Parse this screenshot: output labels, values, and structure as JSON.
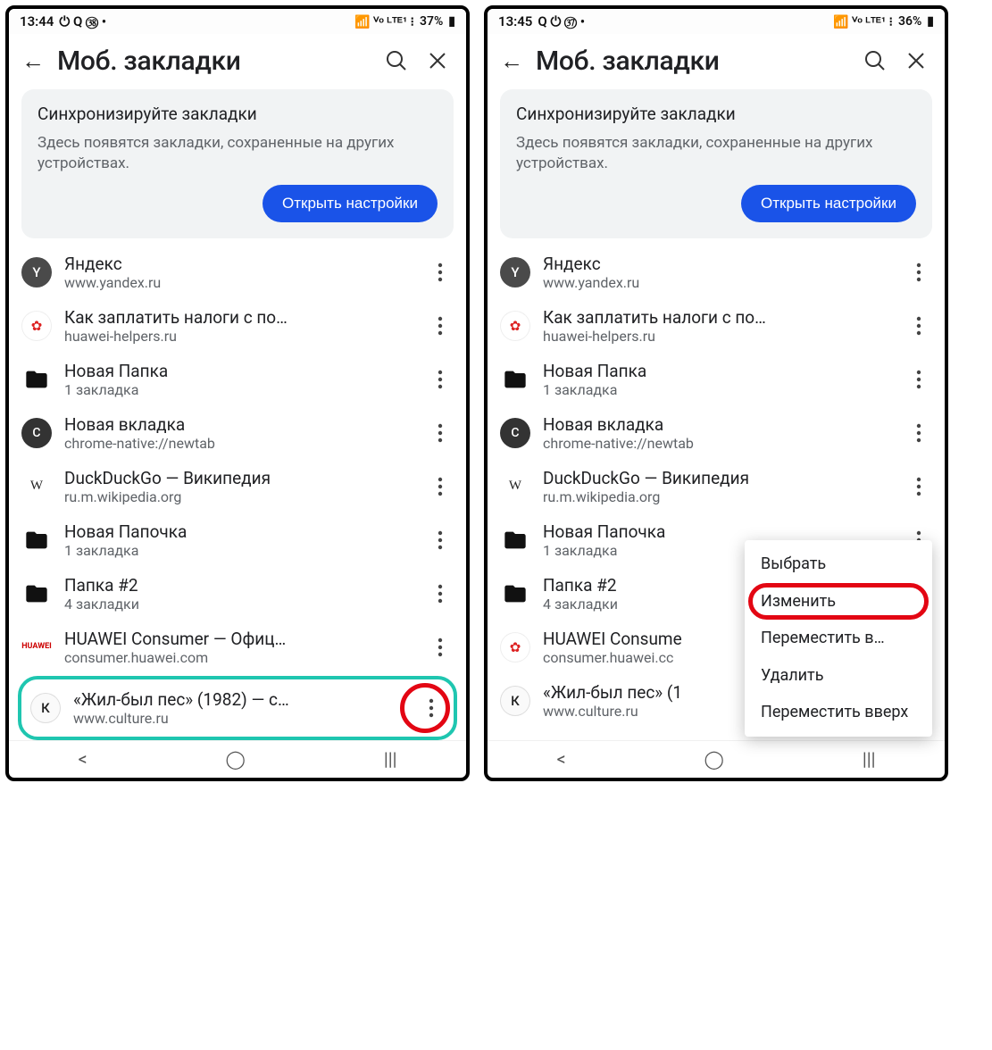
{
  "screens": [
    {
      "id": "left",
      "statusbar": {
        "time": "13:44",
        "battery": "37%",
        "icons": "⏻ Q ㊳ •",
        "net": "📶 ⱽᵒ ᴸᵀᴱ¹ ⁝"
      },
      "header": {
        "title": "Моб. закладки"
      },
      "sync": {
        "heading": "Синхронизируйте закладки",
        "sub": "Здесь появятся закладки, сохраненные на других устройствах.",
        "button": "Открыть настройки"
      },
      "bookmarks": [
        {
          "fav": "Y",
          "favClass": "fav-y",
          "title": "Яндекс",
          "url": "www.yandex.ru"
        },
        {
          "fav": "✿",
          "favClass": "fav-huawei",
          "title": "Как заплатить налоги с по…",
          "url": "huawei-helpers.ru"
        },
        {
          "fav": "folder",
          "favClass": "fav-folder",
          "title": "Новая Папка",
          "url": "1 закладка"
        },
        {
          "fav": "C",
          "favClass": "fav-c",
          "title": "Новая вкладка",
          "url": "chrome-native://newtab"
        },
        {
          "fav": "W",
          "favClass": "fav-w",
          "title": "DuckDuckGo — Википедия",
          "url": "ru.m.wikipedia.org"
        },
        {
          "fav": "folder",
          "favClass": "fav-folder",
          "title": "Новая Папочка",
          "url": "1 закладка"
        },
        {
          "fav": "folder",
          "favClass": "fav-folder",
          "title": "Папка #2",
          "url": "4 закладки"
        },
        {
          "fav": "HUAWEI",
          "favClass": "fav-huaweitext",
          "title": "HUAWEI Consumer — Офиц…",
          "url": "consumer.huawei.com"
        }
      ],
      "highlighted": {
        "fav": "К",
        "favClass": "fav-k",
        "title": "«Жил-был пес» (1982) — с…",
        "url": "www.culture.ru"
      }
    },
    {
      "id": "right",
      "statusbar": {
        "time": "13:45",
        "battery": "36%",
        "icons": "Q ⏻ ㊲ •",
        "net": "📶 ⱽᵒ ᴸᵀᴱ¹ ⁝"
      },
      "header": {
        "title": "Моб. закладки"
      },
      "sync": {
        "heading": "Синхронизируйте закладки",
        "sub": "Здесь появятся закладки, сохраненные на других устройствах.",
        "button": "Открыть настройки"
      },
      "bookmarks": [
        {
          "fav": "Y",
          "favClass": "fav-y",
          "title": "Яндекс",
          "url": "www.yandex.ru"
        },
        {
          "fav": "✿",
          "favClass": "fav-huawei",
          "title": "Как заплатить налоги с по…",
          "url": "huawei-helpers.ru"
        },
        {
          "fav": "folder",
          "favClass": "fav-folder",
          "title": "Новая Папка",
          "url": "1 закладка"
        },
        {
          "fav": "C",
          "favClass": "fav-c",
          "title": "Новая вкладка",
          "url": "chrome-native://newtab"
        },
        {
          "fav": "W",
          "favClass": "fav-w",
          "title": "DuckDuckGo — Википедия",
          "url": "ru.m.wikipedia.org"
        },
        {
          "fav": "folder",
          "favClass": "fav-folder",
          "title": "Новая Папочка",
          "url": "1 закладка"
        },
        {
          "fav": "folder",
          "favClass": "fav-folder",
          "title": "Папка #2",
          "url": "4 закладки"
        },
        {
          "fav": "✿",
          "favClass": "fav-huawei",
          "title": "HUAWEI Consume",
          "url": "consumer.huawei.cc"
        },
        {
          "fav": "К",
          "favClass": "fav-k",
          "title": "«Жил-был пес» (1",
          "url": "www.culture.ru"
        }
      ],
      "contextMenu": [
        {
          "label": "Выбрать",
          "hl": false
        },
        {
          "label": "Изменить",
          "hl": true
        },
        {
          "label": "Переместить в…",
          "hl": false
        },
        {
          "label": "Удалить",
          "hl": false
        },
        {
          "label": "Переместить вверх",
          "hl": false
        }
      ]
    }
  ]
}
